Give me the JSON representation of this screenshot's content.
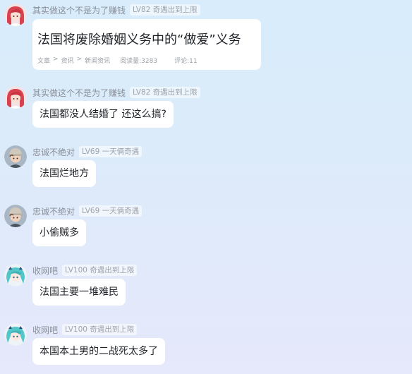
{
  "colors": {
    "background_top": "#d8ecfb",
    "background_bottom": "#e6e8fb",
    "bubble": "#ffffff",
    "name_text": "#8a8f98",
    "message_text": "#1f2329"
  },
  "messages": [
    {
      "user": "其实做这个不是为了赚钱",
      "badge": "LV82 奇遇出到上限",
      "avatar_icon": "red-hair-girl-avatar",
      "card": {
        "title": "法国将废除婚姻义务中的“做爱”义务",
        "crumbs": [
          "文章",
          "资讯",
          "新闻资讯"
        ],
        "crumb_sep": ">",
        "views": "阅读量:3283",
        "comments": "评论:11"
      }
    },
    {
      "user": "其实做这个不是为了赚钱",
      "badge": "LV82 奇遇出到上限",
      "avatar_icon": "red-hair-girl-avatar",
      "text": "法国都没人结婚了 还这么搞?"
    },
    {
      "user": "忠诚不绝对",
      "badge": "LV69 一天俩奇遇",
      "avatar_icon": "cap-boy-avatar",
      "text": "法国烂地方"
    },
    {
      "user": "忠诚不绝对",
      "badge": "LV69 一天俩奇遇",
      "avatar_icon": "cap-boy-avatar",
      "text": "小偷贼多"
    },
    {
      "user": "收网吧",
      "badge": "LV100 奇遇出到上限",
      "avatar_icon": "teal-hair-girl-avatar",
      "text": "法国主要一堆难民"
    },
    {
      "user": "收网吧",
      "badge": "LV100 奇遇出到上限",
      "avatar_icon": "teal-hair-girl-avatar",
      "text": "本国本土男的二战死太多了"
    }
  ]
}
